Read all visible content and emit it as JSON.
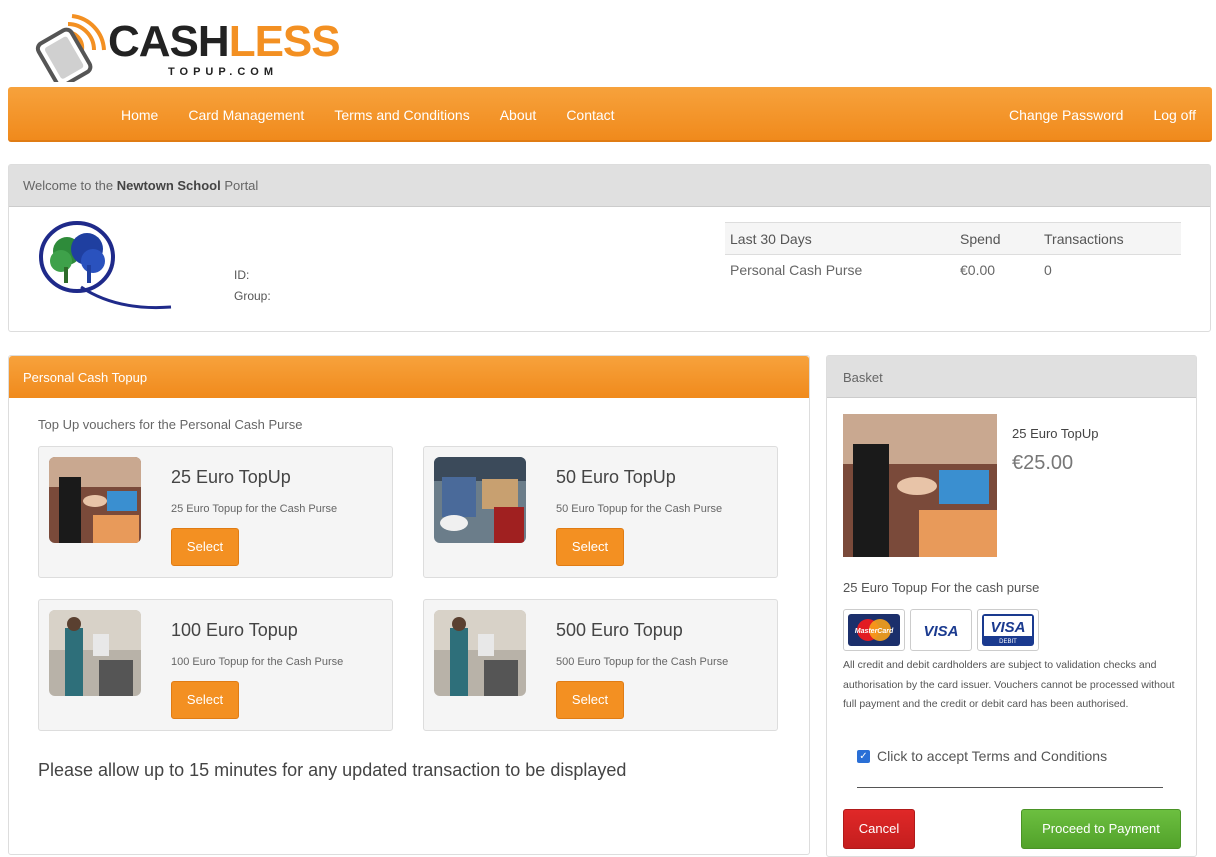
{
  "brand": {
    "name_part1": "CASH",
    "name_part2": "LESS",
    "tagline": "TOPUP.COM",
    "accent_color": "#f39022"
  },
  "nav": {
    "left": [
      "Home",
      "Card Management",
      "Terms and Conditions",
      "About",
      "Contact"
    ],
    "right": [
      "Change Password",
      "Log off"
    ]
  },
  "welcome": {
    "prefix": "Welcome to the",
    "school": "Newtown School",
    "suffix": "Portal",
    "id_label": "ID:",
    "group_label": "Group:"
  },
  "stats": {
    "headers": [
      "Last 30 Days",
      "Spend",
      "Transactions"
    ],
    "rows": [
      {
        "purse": "Personal Cash Purse",
        "spend": "€0.00",
        "transactions": "0"
      }
    ]
  },
  "topup": {
    "title": "Personal Cash Topup",
    "intro": "Top Up vouchers for the Personal Cash Purse",
    "vouchers": [
      {
        "title": "25 Euro TopUp",
        "desc": "25 Euro Topup for the Cash Purse",
        "button": "Select"
      },
      {
        "title": "50 Euro TopUp",
        "desc": "50 Euro Topup for the Cash Purse",
        "button": "Select"
      },
      {
        "title": "100 Euro Topup",
        "desc": "100 Euro Topup for the Cash Purse",
        "button": "Select"
      },
      {
        "title": "500 Euro Topup",
        "desc": "500 Euro Topup for the Cash Purse",
        "button": "Select"
      }
    ],
    "notice": "Please allow up to 15 minutes for any updated transaction to be displayed"
  },
  "basket": {
    "title": "Basket",
    "item_title": "25 Euro TopUp",
    "item_price": "€25.00",
    "item_desc": "25 Euro Topup For the cash purse",
    "card_icons": [
      "mastercard-icon",
      "visa-icon",
      "visa-debit-icon"
    ],
    "card_labels": {
      "mastercard": "MasterCard",
      "visa": "VISA",
      "visa_debit": "VISA",
      "debit": "DEBIT"
    },
    "legal": "All credit and debit cardholders are subject to validation checks and authorisation by the card issuer. Vouchers cannot be processed without full payment and the credit or debit card has been authorised.",
    "terms_label": "Click to accept Terms and Conditions",
    "terms_checked": true,
    "cancel_label": "Cancel",
    "proceed_label": "Proceed to Payment",
    "cancel_color": "#d32424",
    "proceed_color": "#5eb234"
  }
}
